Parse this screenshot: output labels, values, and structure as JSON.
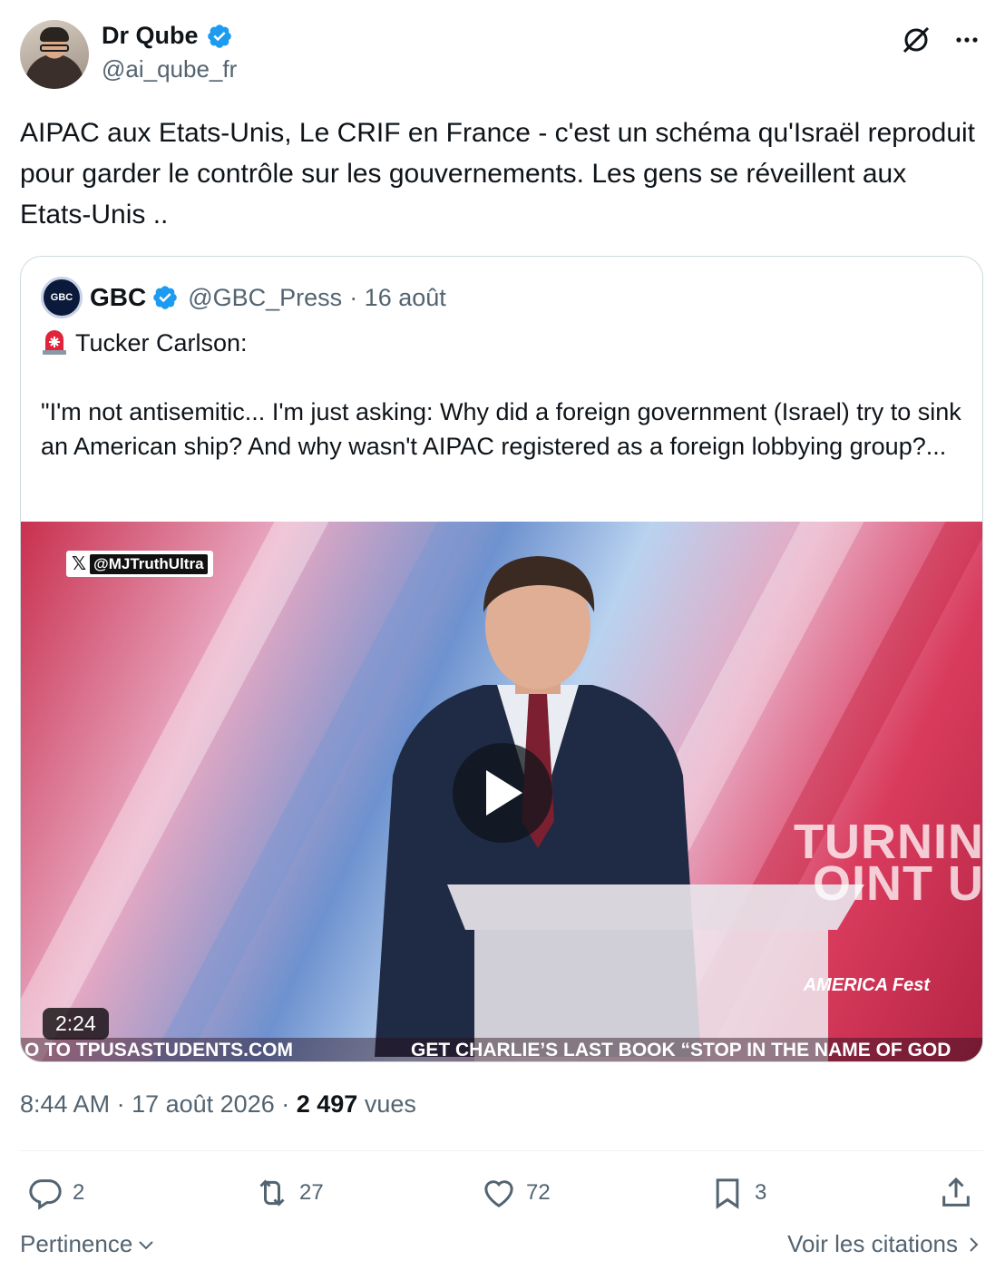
{
  "author": {
    "display_name": "Dr Qube",
    "handle": "@ai_qube_fr"
  },
  "tweet": {
    "text": "AIPAC aux Etats-Unis, Le CRIF en France - c'est un schéma qu'Israël reproduit pour garder le contrôle sur les gouvernements. Les gens se réveillent aux Etats-Unis .."
  },
  "quoted": {
    "avatar_text": "GBC",
    "display_name": "GBC",
    "handle": "@GBC_Press",
    "date": "· 16 août",
    "heading": "Tucker Carlson:",
    "body": "\"I'm not antisemitic... I'm just asking: Why did a foreign government (Israel) try to sink an American ship? And why wasn't AIPAC registered as a foreign lobbying group?...",
    "video": {
      "watermark": "@MJTruthUltra",
      "duration": "2:24",
      "ticker_left": "O TO TPUSASTUDENTS.COM",
      "ticker_right": "GET CHARLIE’S LAST BOOK “STOP IN THE NAME OF GOD",
      "stage_text": "TURNIN\nOINT U",
      "brand": "AMERICA Fest"
    }
  },
  "meta": {
    "time": "8:44 AM",
    "date": "· 17 août 2026 ·",
    "views": "2 497",
    "views_label": "vues"
  },
  "actions": {
    "replies": "2",
    "reposts": "27",
    "likes": "72",
    "bookmarks": "3"
  },
  "footer": {
    "sort_label": "Pertinence",
    "quotes_label": "Voir les citations"
  },
  "colors": {
    "verified": "#1d9bf0",
    "text": "#0f1419",
    "secondary": "#536471",
    "border": "#cfd9de"
  }
}
